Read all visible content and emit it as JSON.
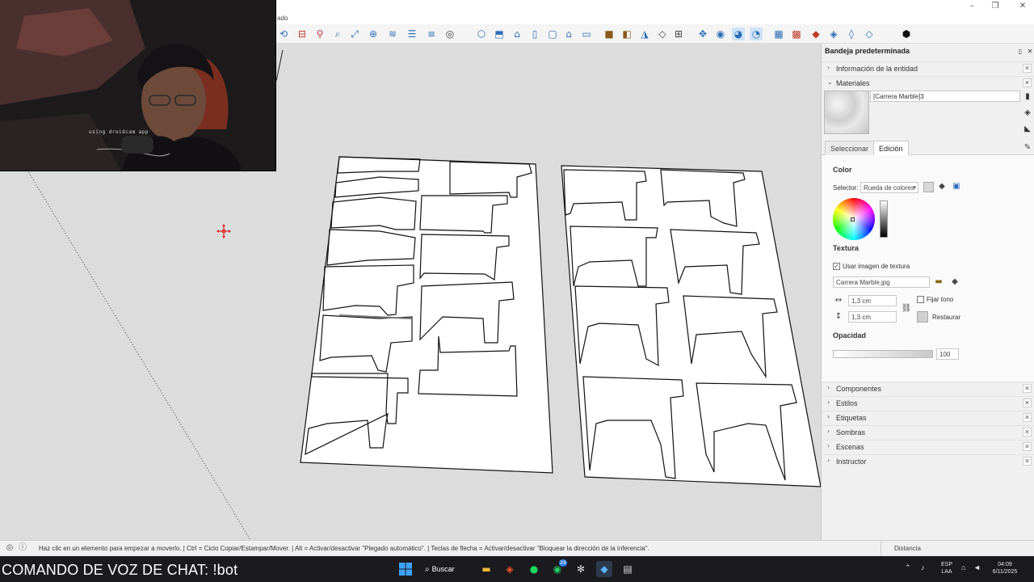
{
  "window": {
    "title_fragment": "ado",
    "controls": [
      "–",
      "❐",
      "✕"
    ]
  },
  "webcam": {
    "overlay_text": "using droidcam app"
  },
  "toolbar": {
    "icons": [
      "orbit-icon",
      "section-icon",
      "walk-icon",
      "zoom-icon",
      "zoom-extents-icon",
      "outliner-icon",
      "xray-icon",
      "layers-icon",
      "styles-icon",
      "profile-icon",
      "iso-view-icon",
      "top-view-icon",
      "front-view-icon",
      "right-view-icon",
      "back-view-icon",
      "left-view-icon",
      "bottom-view-icon",
      "box-icon",
      "package-icon",
      "paint-icon",
      "tape-icon",
      "dimension-icon",
      "move-icon",
      "scale-icon",
      "orbit-active-icon",
      "pan-active-icon",
      "sandbox-icon",
      "grid-icon",
      "solid-tools-icon",
      "intersect-icon",
      "trim-icon",
      "outer-shell-icon",
      "sketchup-logo-icon"
    ],
    "active": [
      "orbit-active-icon",
      "pan-active-icon"
    ]
  },
  "tray": {
    "title": "Bandeja predeterminada",
    "sections_top": [
      {
        "label": "Información de la entidad",
        "expanded": false
      },
      {
        "label": "Materiales",
        "expanded": true
      }
    ],
    "material": {
      "name": "[Carrera Marble]3",
      "tabs": [
        "Seleccionar",
        "Edición"
      ],
      "active_tab": "Edición",
      "color_heading": "Color",
      "selector_label": "Selector:",
      "selector_value": "Rueda de colores",
      "texture_heading": "Textura",
      "use_texture_label": "Usar imagen de textura",
      "use_texture_checked": true,
      "texture_file": "Carrera Marble.jpg",
      "width_value": "1,3 cm",
      "height_value": "1,3 cm",
      "fix_hue_label": "Fijar tono",
      "reset_label": "Restaurar",
      "opacity_heading": "Opacidad",
      "opacity_value": "100"
    },
    "sections_bottom": [
      {
        "label": "Componentes"
      },
      {
        "label": "Estilos"
      },
      {
        "label": "Etiquetas"
      },
      {
        "label": "Sombras"
      },
      {
        "label": "Escenas"
      },
      {
        "label": "Instructor"
      }
    ]
  },
  "status": {
    "message": "Haz clic en un elemento para empezar a moverlo. | Ctrl = Ciclo Copiar/Estampar/Mover. | Alt = Activar/desactivar \"Plegado automático\". | Teclas de flecha = Activar/desactivar \"Bloquear la dirección de la inferencia\".",
    "distance_label": "Distancia"
  },
  "taskbar": {
    "chat_command": "COMANDO DE VOZ DE CHAT: !bot",
    "search_label": "Buscar",
    "whatsapp_badge": "29",
    "language_line1": "ESP",
    "language_line2": "LAA",
    "time": "04:09",
    "date": "6/11/2025"
  },
  "colors": {
    "viewport_bg": "#dcdcdc",
    "taskbar_bg": "#1b1b1f",
    "accent": "#cfe3f6"
  }
}
